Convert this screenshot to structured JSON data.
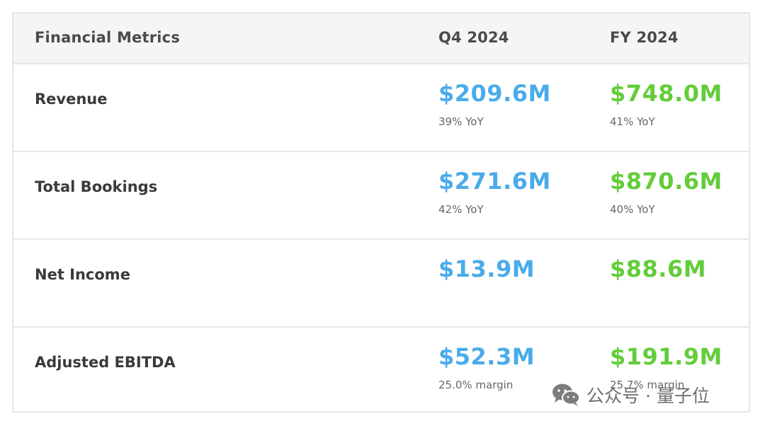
{
  "header": {
    "metric": "Financial Metrics",
    "q4": "Q4 2024",
    "fy": "FY 2024"
  },
  "rows": [
    {
      "label": "Revenue",
      "q4_value": "$209.6M",
      "q4_sub": "39% YoY",
      "fy_value": "$748.0M",
      "fy_sub": "41% YoY"
    },
    {
      "label": "Total Bookings",
      "q4_value": "$271.6M",
      "q4_sub": "42% YoY",
      "fy_value": "$870.6M",
      "fy_sub": "40% YoY"
    },
    {
      "label": "Net Income",
      "q4_value": "$13.9M",
      "q4_sub": "",
      "fy_value": "$88.6M",
      "fy_sub": ""
    },
    {
      "label": "Adjusted EBITDA",
      "q4_value": "$52.3M",
      "q4_sub": "25.0% margin",
      "fy_value": "$191.9M",
      "fy_sub": "25.7% margin"
    }
  ],
  "colors": {
    "q4_accent": "#4aabea",
    "fy_accent": "#63cc3a",
    "border": "#e6e6e6"
  },
  "watermark": {
    "text": "公众号 · 量子位",
    "icon": "wechat-icon"
  }
}
